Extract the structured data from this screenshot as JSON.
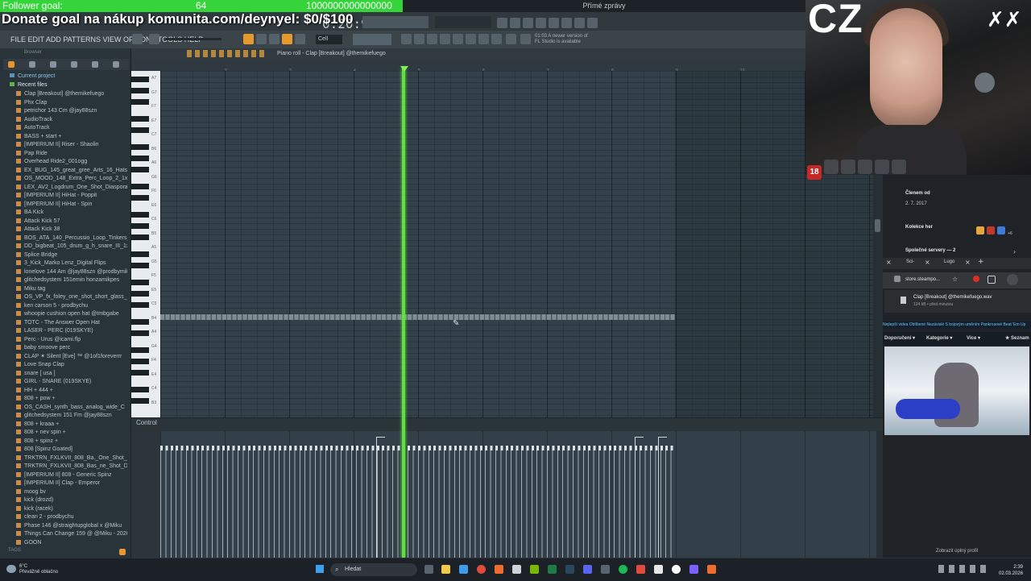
{
  "overlay": {
    "follower_label": "Follower goal:",
    "follower_count": "64",
    "follower_target": "1000000000000000",
    "donate_text": "Donate goal na nákup komunita.com/deynyel: $0/$100",
    "webcam_label": "CZ"
  },
  "window": {
    "title": "Přímé zprávy"
  },
  "fl": {
    "menu": "FILE  EDIT  ADD  PATTERNS  VIEW  OPTIONS  TOOLS  HELP",
    "time": "0:20:95",
    "snap": "Cell",
    "update_line1": "01:03  A newer version of",
    "update_line2": "FL Studio is available"
  },
  "browser": {
    "header": "Browser",
    "folders": [
      "Current project",
      "Recent files"
    ],
    "items": [
      "Clap [Breakout] @themikefuego",
      "Phx Clap",
      "petrichor 143 Cm @jay88szn",
      "AudioTrack",
      "AutoTrack",
      "BASS + start +",
      "[IMPERIUM II] Riser - Shaolin",
      "Pap Ride",
      "Overhead Ride2_001ogg",
      "EX_BUG_145_great_gree_Arts_16_Hats_1x144bpm",
      "OS_MOOD_148_Extra_Perc_Loop_2_1x144bpm",
      "LEX_AV2_Logdrum_One_Shot_Diaspora_C",
      "[IMPERIUM II] HiHat - Poppit",
      "[IMPERIUM II] HiHat - Spin",
      "BA Kick",
      "Attack Kick 57",
      "Attack Kick 38",
      "BOS_ATA_140_Percussio_Loop_Tinkers_1x144bpm",
      "DD_bigbeat_105_drum_g_h_snare_III_1x144bpm",
      "Splice Bridge",
      "3_Kick_Marko Lenz_Digital Flips",
      "lonelove 144 Am @jay88szn @prodbymiku",
      "glitchedsystem 151emin honzamikpes",
      "Miku tag",
      "OS_VP_fx_foley_one_shot_short_glass_shatter",
      "ken carson 5 - prodbychu",
      "whoopie cushion open hat @tmbgabe",
      "TOTC - The Answer Open Hat",
      "LASER - PERC (019SKYE)",
      "Perc - Urus @icami.flp",
      "baby smoove perc",
      "CLAP ✶ Silent [Eve] ™ @1of1foreverrr",
      "Love Snap Clap",
      "snare [ usa ]",
      "GIRL - SNARE (019SKYE)",
      "HH + 444 +",
      "808 + pow +",
      "OS_CASH_synth_bass_analog_wide_C",
      "glitchedsystem 151 Fm @jay88szn",
      "808 + kraaa +",
      "808 + nev spin +",
      "808 + spinz +",
      "808 [Spinz Goated]",
      "TRKTRN_FXLKVII_808_Ba._One_Shot_Cm_Spinz_C",
      "TRKTRN_FXLKVII_808_Bas_ne_Shot_Dirty_Spinz_C",
      "[IMPERIUM II] 808 - Generic Spinz",
      "[IMPERIUM II] Clap - Emperor",
      "moog bv",
      "kick (drozd)",
      "kick (racek)",
      "clean 2 - prodbychu",
      "Phase 146 @straightupglobal x @Miku",
      "Things Can Change 159 @ @Miku - 2026-Feb-28_4",
      "GOON"
    ],
    "tags_label": "TAGS"
  },
  "piano_roll": {
    "title": "Piano roll - Clap [Breakout] @themikefuego",
    "ruler": [
      "2",
      "3",
      "4",
      "5",
      "6",
      "7",
      "8",
      "9",
      "10"
    ],
    "key_labels": [
      "A7",
      "G7",
      "F7",
      "E7",
      "C7",
      "B6",
      "A6",
      "G6",
      "F6",
      "E6",
      "C6",
      "B5",
      "A5",
      "G5",
      "F5",
      "E5",
      "C5",
      "B4",
      "A4",
      "G4",
      "F4",
      "E4",
      "C4",
      "B3"
    ],
    "control_label": "Control"
  },
  "discord": {
    "member_since_label": "Členem od",
    "member_since_date": "2. 7. 2017",
    "games_label": "Kolekce her",
    "games_more": "+6",
    "servers_label": "Společné servery — 2",
    "profile_link": "Zobrazit úplný profil"
  },
  "chrome": {
    "tab1": "Sci-",
    "tab2": "Lugo",
    "address": "store.steampo...",
    "download_name": "Clap [Breakout] @themikefuego.wav",
    "download_size": "124 kB • před minutou",
    "steam_tags": "Nejlepší videa   Oblíbené   Nezávislé   S bojovým uměním   Pankrosové   Beat 'Em Up",
    "steam_nav": [
      "Doporučení ▾",
      "Kategorie ▾",
      "Více ▾",
      "★ Seznam"
    ]
  },
  "taskbar": {
    "weather_temp": "6°C",
    "weather_desc": "Převážně oblačno",
    "search": "Hledat",
    "time": "2:39",
    "date": "02.03.2026"
  }
}
